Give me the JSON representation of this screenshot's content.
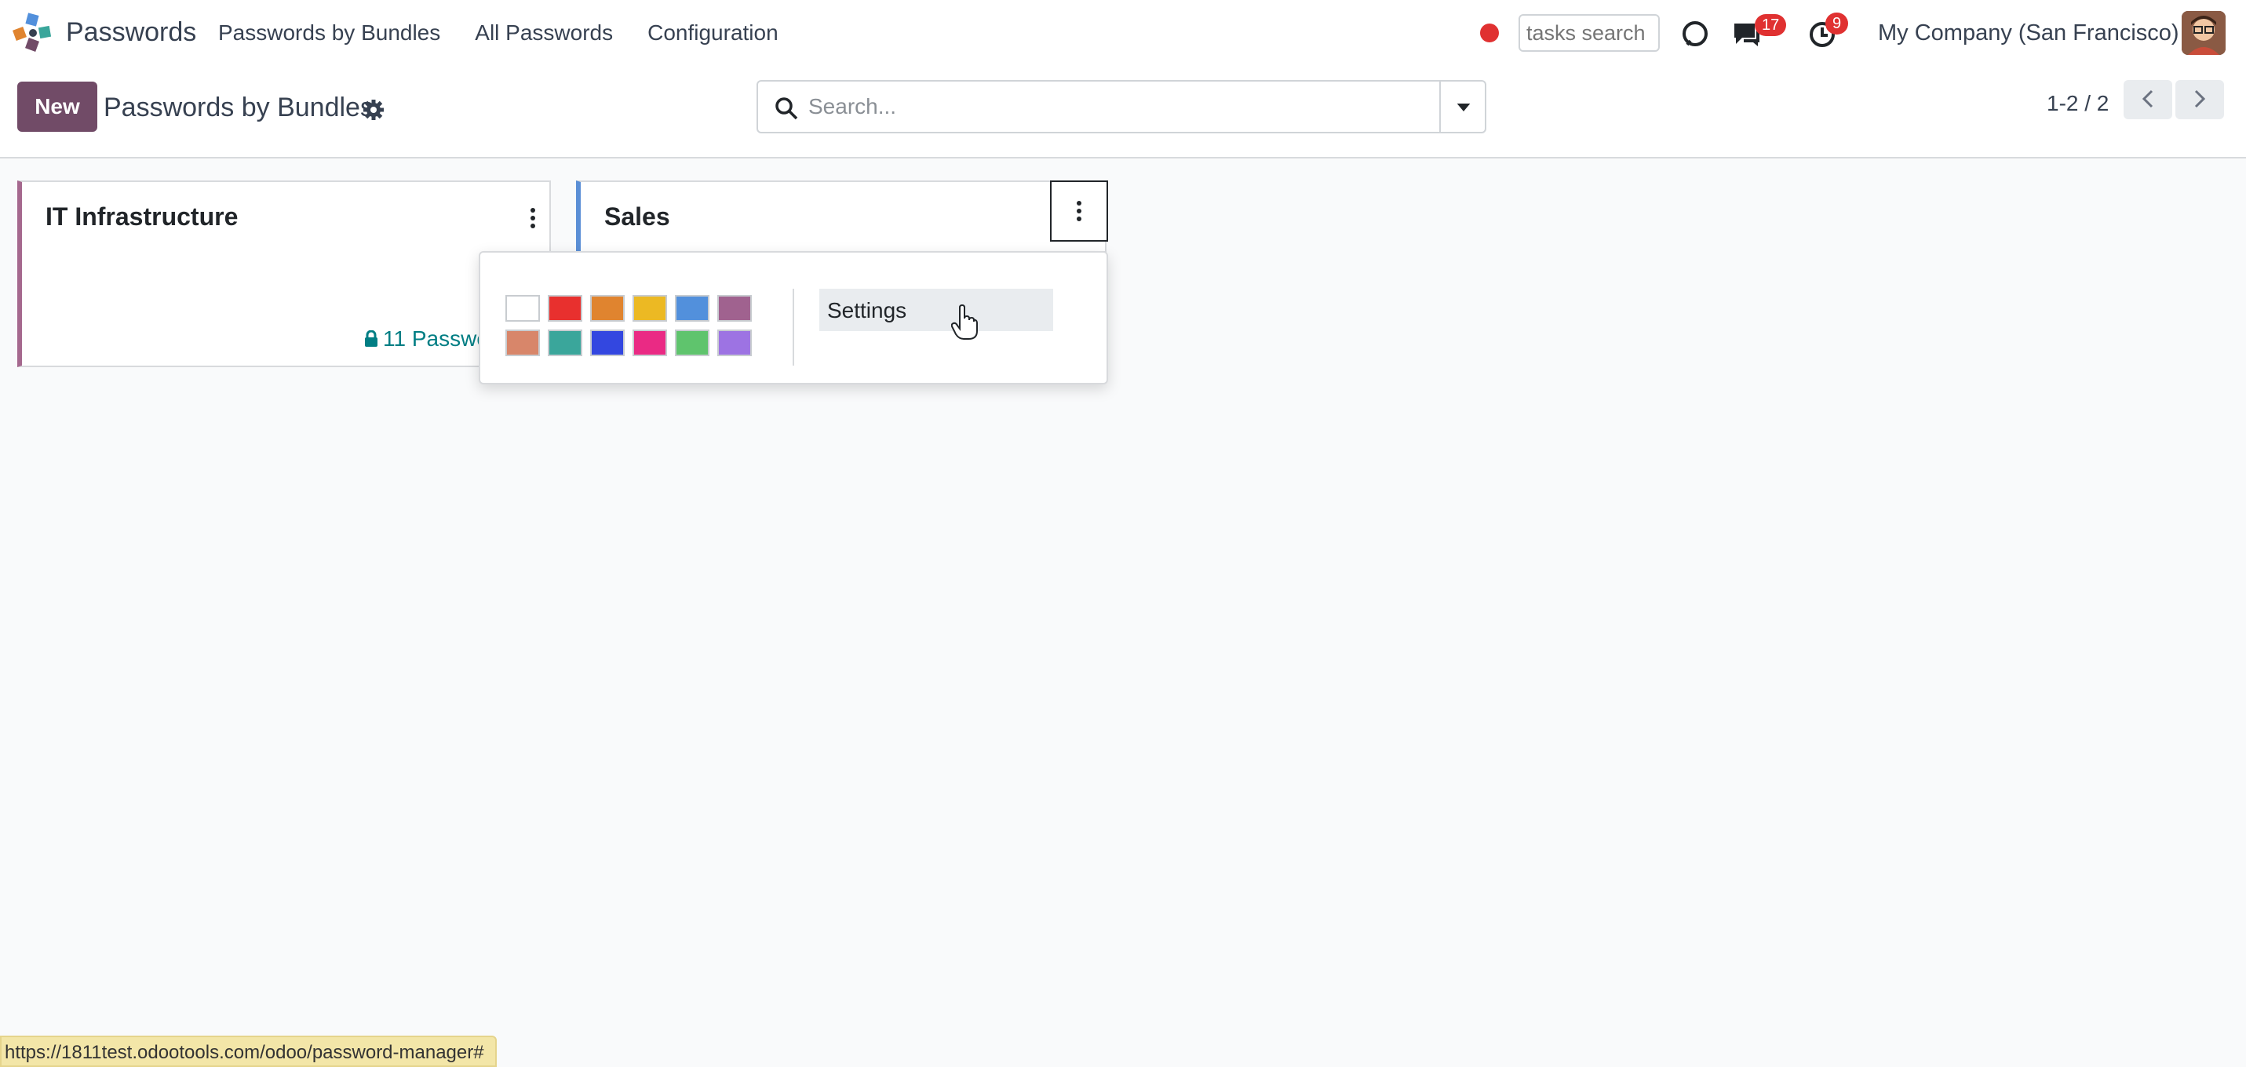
{
  "navbar": {
    "app_name": "Passwords",
    "menu": [
      "Passwords by Bundles",
      "All Passwords",
      "Configuration"
    ],
    "tasks_search_placeholder": "tasks search",
    "messages_badge": "17",
    "activities_badge": "9",
    "company": "My Company (San Francisco)"
  },
  "control_panel": {
    "new_label": "New",
    "title": "Passwords by Bundles",
    "search_placeholder": "Search...",
    "pager_value": "1-2 / 2"
  },
  "cards": [
    {
      "title": "IT Infrastructure",
      "count_label": "11 Passwo",
      "color": "#a5688e"
    },
    {
      "title": "Sales",
      "color": "#5b8fd6"
    }
  ],
  "dropdown": {
    "colors": [
      "#ffffff",
      "#e8302e",
      "#e0842f",
      "#ecb923",
      "#5290dc",
      "#a0628f",
      "#d8866a",
      "#3aa69b",
      "#3347e0",
      "#ea2a84",
      "#5fc46d",
      "#9d73e3"
    ],
    "settings_label": "Settings"
  },
  "status_bar": {
    "url": "https://1811test.odootools.com/odoo/password-manager#"
  }
}
